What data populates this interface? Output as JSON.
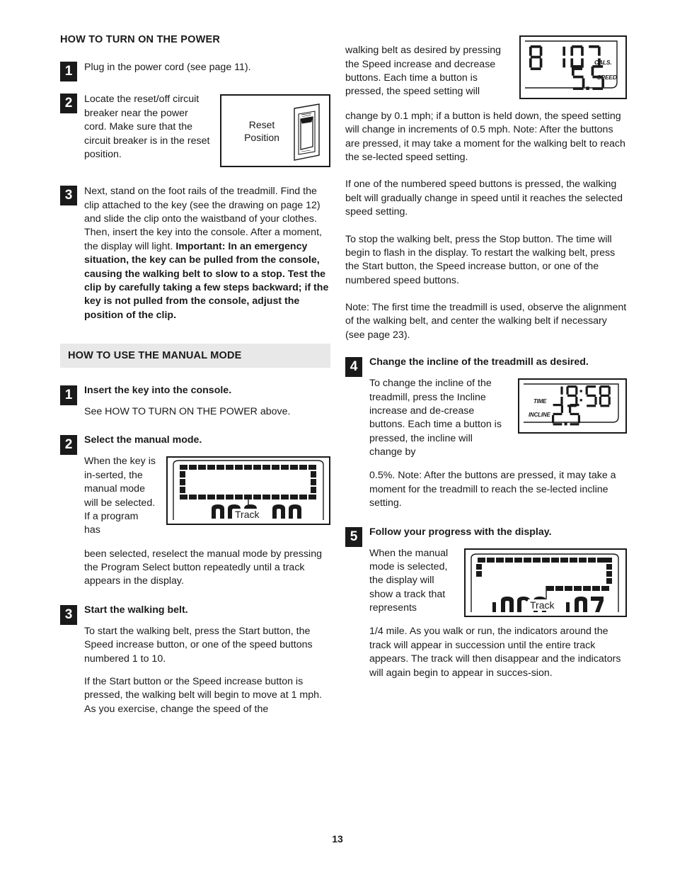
{
  "page": {
    "number": "13"
  },
  "left_column": {
    "section1": {
      "heading": "HOW TO TURN ON THE POWER",
      "steps": [
        {
          "number": "1",
          "text": "Plug in the power cord (see page 11)."
        },
        {
          "number": "2",
          "text": "Locate the reset/off circuit breaker near the power cord. Make sure that the circuit breaker is in the reset position."
        },
        {
          "number": "3",
          "text_normal": "Next, stand on the foot rails of the treadmill. Find the clip attached to the key (see the drawing on page 12) and slide the clip onto the waistband of your clothes. Then, insert the key into the console. After a moment, the display will light. ",
          "text_bold": "Important: In an emergency situation, the key can be pulled from the console, causing the walking belt to slow to a stop. Test the clip by carefully taking a few steps backward; if the key is not pulled from the console, adjust the position of the clip."
        }
      ],
      "figure_reset": {
        "label_line1": "Reset",
        "label_line2": "Position",
        "icon": "circuit-breaker-switch"
      }
    },
    "section2": {
      "heading": "HOW TO USE THE MANUAL MODE",
      "steps": [
        {
          "number": "1",
          "title": "Insert the key into the console.",
          "body": "See HOW TO TURN ON THE POWER above."
        },
        {
          "number": "2",
          "title": "Select the manual mode.",
          "body_wrap": "When the key is in-serted, the manual mode will be selected. If a program has",
          "body_rest": "been selected, reselect the manual mode by pressing the Program Select button repeatedly until a track appears in the display."
        },
        {
          "number": "3",
          "title": "Start the walking belt.",
          "body1": "To start the walking belt, press the Start button, the Speed increase button, or one of the speed buttons numbered 1 to 10.",
          "body2": "If the Start button or the Speed increase button is pressed, the walking belt will begin to move at 1 mph. As you exercise, change the speed of the"
        }
      ],
      "figure_track": {
        "caption": "Track"
      }
    }
  },
  "right_column": {
    "paragraphs": {
      "wrap_speed": "walking belt as desired by pressing the Speed increase and decrease buttons. Each time a button is pressed, the speed setting will",
      "speed_rest": "change by 0.1 mph; if a button is held down, the speed setting will change in increments of 0.5 mph. Note: After the buttons are pressed, it may take a moment for the walking belt to reach the se-lected speed setting.",
      "numbered_speed": "If one of the numbered speed buttons is pressed, the walking belt will gradually change in speed until it reaches the selected speed setting.",
      "stop_belt": "To stop the walking belt, press the Stop button. The time will begin to flash in the display. To restart the walking belt, press the Start button, the Speed increase button, or one of the numbered speed buttons.",
      "note_alignment": "Note: The first time the treadmill is used, observe the alignment of the walking belt, and center the walking belt if necessary (see page 23)."
    },
    "steps": [
      {
        "number": "4",
        "title": "Change the incline of the treadmill as desired.",
        "body_wrap": "To change the incline of the treadmill, press the Incline increase and de-crease buttons. Each time a button is pressed, the incline will change by",
        "body_rest": "0.5%. Note: After the buttons are pressed, it may take a moment for the treadmill to reach the se-lected incline setting."
      },
      {
        "number": "5",
        "title": "Follow your progress with the display.",
        "body_wrap": "When the manual mode is selected, the display will show a track that represents",
        "body_rest": "1/4 mile. As you walk or run, the indicators around the track will appear in succession until the entire track appears. The track will then disappear and the indicators will again begin to appear in succes-sion."
      }
    ],
    "figure_cals": {
      "value_left": "8",
      "value_main": "107",
      "label_main": "CALS.",
      "value_speed": "5.5",
      "label_speed": "SPEED"
    },
    "figure_incline": {
      "label_time": "TIME",
      "value_time": "19:58",
      "label_incline": "INCLINE",
      "value_incline": "2.5"
    },
    "figure_track": {
      "caption": "Track"
    }
  }
}
